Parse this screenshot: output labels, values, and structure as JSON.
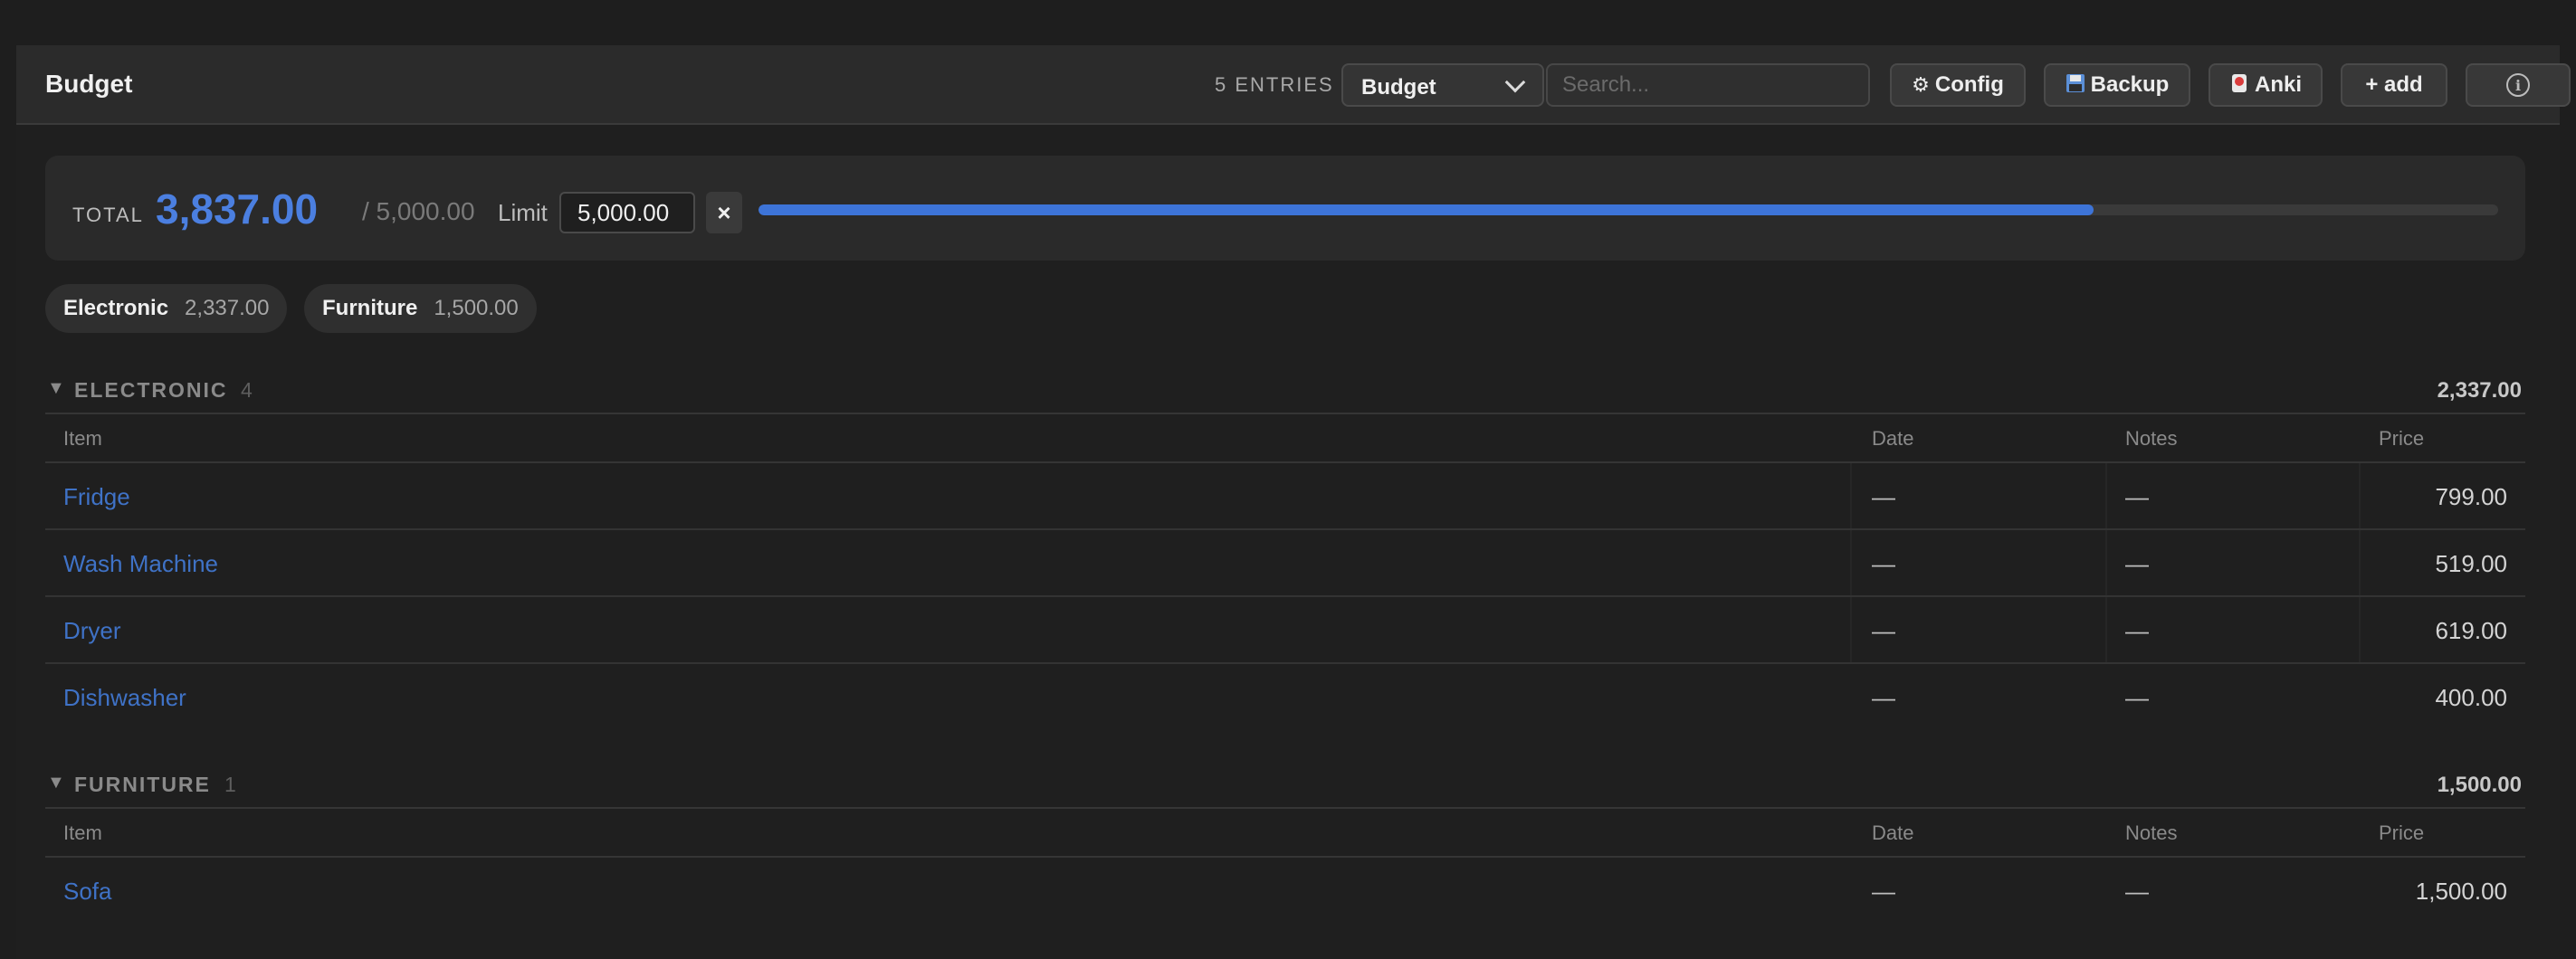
{
  "header": {
    "title": "Budget",
    "entries_label": "5 ENTRIES",
    "select_value": "Budget",
    "search_placeholder": "Search...",
    "buttons": {
      "config": "Config",
      "backup": "Backup",
      "anki": "Anki",
      "add": "+ add"
    },
    "icons": {
      "config": "gear-icon",
      "backup": "floppy-disk-icon",
      "anki": "anki-logo-icon",
      "info": "info-icon"
    }
  },
  "summary": {
    "total_label": "TOTAL",
    "total_value": "3,837.00",
    "limit_display": "/ 5,000.00",
    "limit_label": "Limit",
    "limit_input_value": "5,000.00",
    "clear_label": "×",
    "progress_fraction": 0.7674,
    "progress_color": "#3d74d8"
  },
  "chips": [
    {
      "name": "Electronic",
      "amount": "2,337.00"
    },
    {
      "name": "Furniture",
      "amount": "1,500.00"
    }
  ],
  "columns": {
    "item": "Item",
    "date": "Date",
    "notes": "Notes",
    "price": "Price"
  },
  "groups": [
    {
      "toggle": "▼",
      "name": "ELECTRONIC",
      "count": "4",
      "total": "2,337.00",
      "rows": [
        {
          "item": "Fridge",
          "date": "—",
          "notes": "—",
          "price": "799.00"
        },
        {
          "item": "Wash Machine",
          "date": "—",
          "notes": "—",
          "price": "519.00"
        },
        {
          "item": "Dryer",
          "date": "—",
          "notes": "—",
          "price": "619.00"
        },
        {
          "item": "Dishwasher",
          "date": "—",
          "notes": "—",
          "price": "400.00"
        }
      ]
    },
    {
      "toggle": "▼",
      "name": "FURNITURE",
      "count": "1",
      "total": "1,500.00",
      "rows": [
        {
          "item": "Sofa",
          "date": "—",
          "notes": "—",
          "price": "1,500.00"
        }
      ]
    }
  ],
  "colors": {
    "accent": "#4b7fe0",
    "link": "#3f72c6",
    "background": "#1f1f1f"
  }
}
